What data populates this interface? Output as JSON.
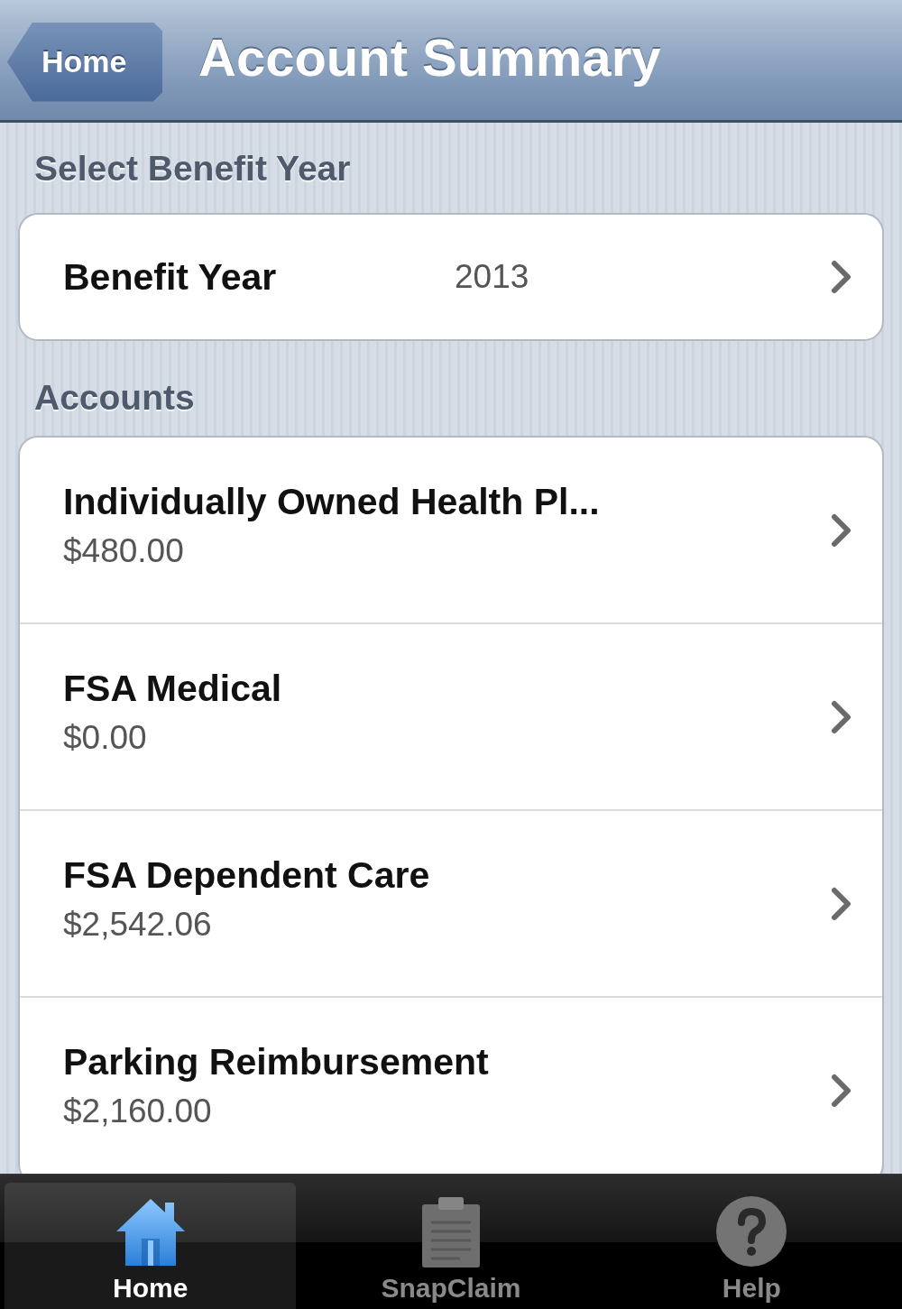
{
  "nav_bar": {
    "back_button": "Home",
    "title": "Account Summary"
  },
  "benefit_year_section": {
    "header": "Select Benefit Year",
    "rows": [
      {
        "label": "Benefit Year",
        "value": "2013"
      }
    ]
  },
  "accounts_section": {
    "header": "Accounts",
    "rows": [
      {
        "name": "Individually Owned Health Pl...",
        "amount": "$480.00"
      },
      {
        "name": "FSA Medical",
        "amount": "$0.00"
      },
      {
        "name": "FSA Dependent Care",
        "amount": "$2,542.06"
      },
      {
        "name": "Parking Reimbursement",
        "amount": "$2,160.00"
      }
    ]
  },
  "tab_bar": {
    "tabs": [
      {
        "label": "Home",
        "selected": true
      },
      {
        "label": "SnapClaim",
        "selected": false
      },
      {
        "label": "Help",
        "selected": false
      }
    ]
  }
}
